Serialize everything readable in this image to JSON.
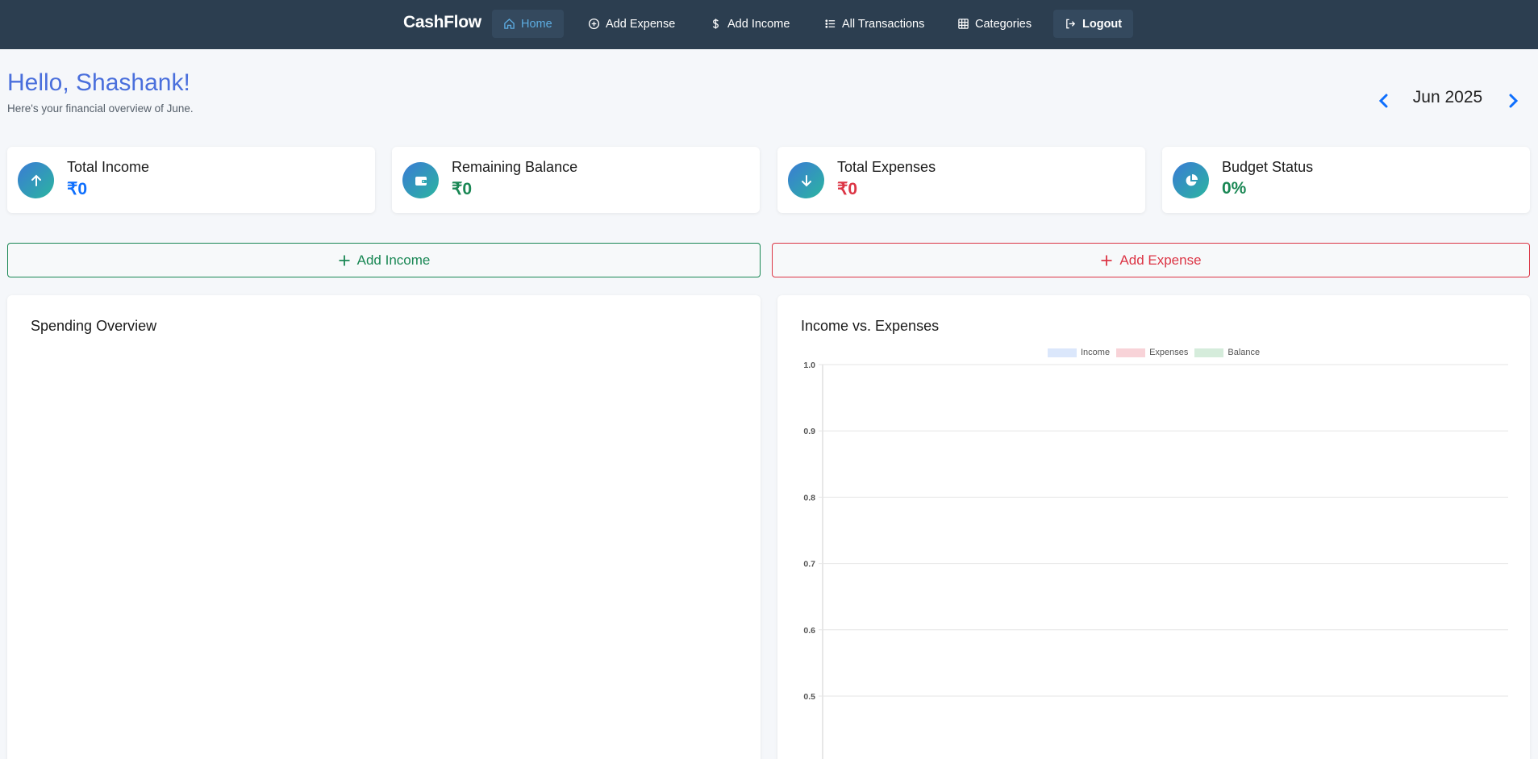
{
  "nav": {
    "brand": "CashFlow",
    "items": [
      {
        "label": "Home",
        "icon": "home-icon",
        "active": true
      },
      {
        "label": "Add Expense",
        "icon": "plus-circle-icon"
      },
      {
        "label": "Add Income",
        "icon": "dollar-icon"
      },
      {
        "label": "All Transactions",
        "icon": "list-icon"
      },
      {
        "label": "Categories",
        "icon": "grid-icon"
      },
      {
        "label": "Logout",
        "icon": "logout-icon"
      }
    ]
  },
  "header": {
    "greeting": "Hello, Shashank!",
    "subtitle": "Here's your financial overview of June."
  },
  "month_selector": {
    "label": "Jun 2025",
    "prev_icon": "chevron-left-icon",
    "next_icon": "chevron-right-icon"
  },
  "stats": [
    {
      "label": "Total Income",
      "value": "₹0",
      "icon": "arrow-up-icon",
      "color": "#0d6efd"
    },
    {
      "label": "Remaining Balance",
      "value": "₹0",
      "icon": "wallet-icon",
      "color": "#198754"
    },
    {
      "label": "Total Expenses",
      "value": "₹0",
      "icon": "arrow-down-icon",
      "color": "#dc3545"
    },
    {
      "label": "Budget Status",
      "value": "0%",
      "icon": "pie-chart-icon",
      "color": "#198754"
    }
  ],
  "actions": {
    "add_income": "Add Income",
    "add_expense": "Add Expense"
  },
  "panels": {
    "spending_title": "Spending Overview",
    "income_expenses_title": "Income vs. Expenses"
  },
  "colors": {
    "navbar": "#2c3e50",
    "income": "#0d6efd",
    "balance": "#198754",
    "expense": "#dc3545",
    "accent": "#4a6fdc"
  },
  "chart_data": {
    "type": "bar",
    "title": "Income vs. Expenses",
    "series": [
      {
        "name": "Income",
        "values": [],
        "color": "#dbe7fb"
      },
      {
        "name": "Expenses",
        "values": [],
        "color": "#f8d3d8"
      },
      {
        "name": "Balance",
        "values": [],
        "color": "#d5ecdb"
      }
    ],
    "legend_position": "top",
    "yticks": [
      "1.0",
      "0.9",
      "0.8",
      "0.7",
      "0.6",
      "0.5"
    ],
    "ylim": [
      0,
      1.0
    ],
    "grid": true
  }
}
